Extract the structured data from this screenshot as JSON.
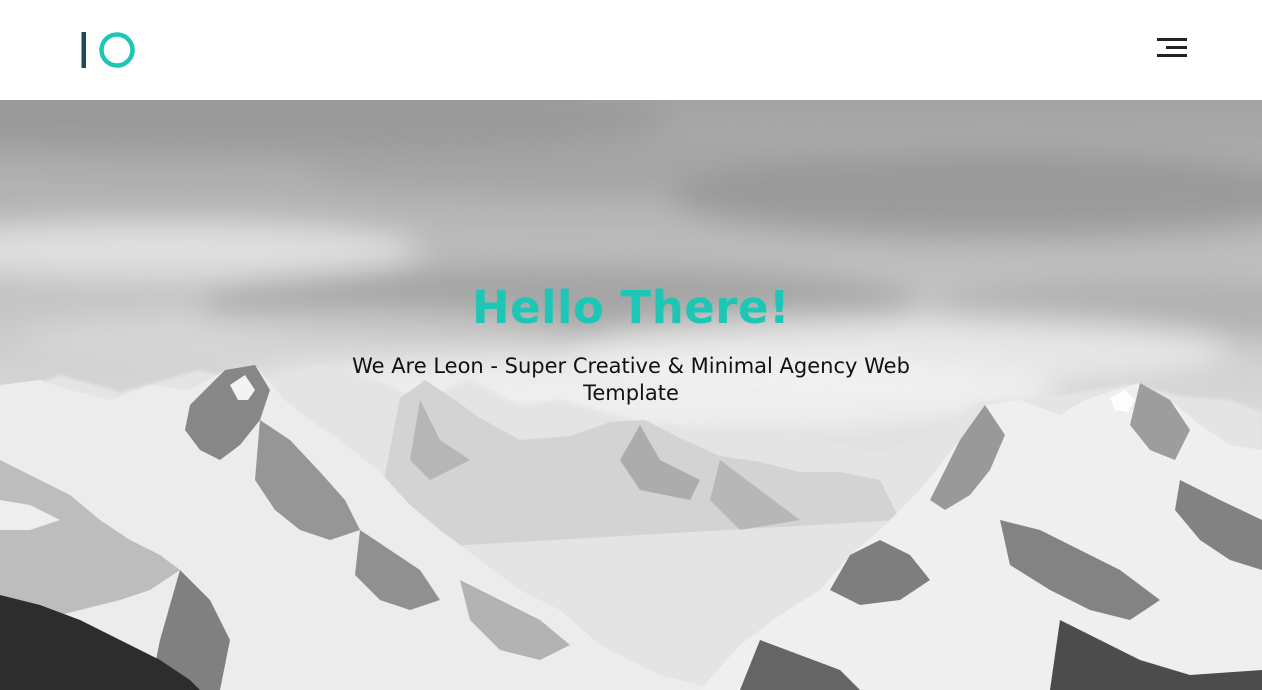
{
  "header": {
    "logo_icon": "io-logo-icon",
    "menu_icon": "hamburger-menu-icon"
  },
  "hero": {
    "title": "Hello There!",
    "subtitle": "We Are Leon - Super Creative & Minimal Agency Web Template",
    "background_icon": "snowy-mountains-image"
  },
  "colors": {
    "accent": "#1ec6b6",
    "logo_dark": "#1d4a56",
    "text_dark": "#111111",
    "menu_icon": "#222222",
    "header_bg": "#ffffff"
  }
}
